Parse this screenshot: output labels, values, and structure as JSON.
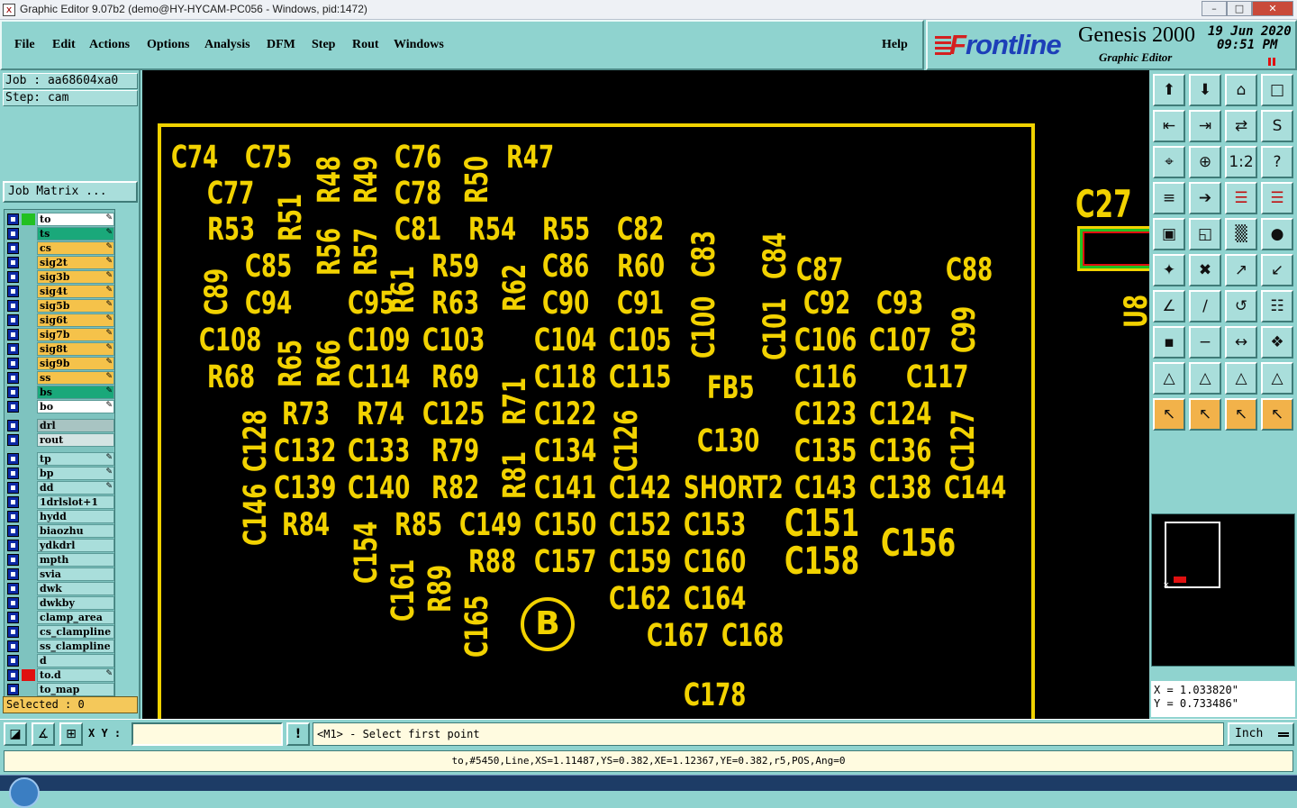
{
  "window": {
    "title": "Graphic Editor 9.07b2 (demo@HY-HYCAM-PC056 - Windows, pid:1472)",
    "icon": "x-app-icon",
    "controls": {
      "minimize": "–",
      "restore": "□",
      "close": "✕"
    }
  },
  "menu": {
    "items": [
      "File",
      "Edit",
      "Actions",
      "Options",
      "Analysis",
      "DFM",
      "Step",
      "Rout",
      "Windows"
    ],
    "help": "Help"
  },
  "brand": {
    "logo": "Frontline",
    "product": "Genesis 2000",
    "subtitle": "Graphic Editor",
    "date": "19 Jun 2020",
    "time": "09:51 PM"
  },
  "left": {
    "job": "Job : aa68604xa0",
    "step": "Step: cam",
    "job_matrix": "Job Matrix ...",
    "selected": "Selected : 0",
    "layers": [
      {
        "name": "to",
        "color": "#ffffff",
        "mark": "#22c022",
        "pen": true
      },
      {
        "name": "ts",
        "color": "#1aa87a",
        "pen": true
      },
      {
        "name": "cs",
        "color": "#f5c24a",
        "pen": true
      },
      {
        "name": "sig2t",
        "color": "#f5c24a",
        "pen": true
      },
      {
        "name": "sig3b",
        "color": "#f5c24a",
        "pen": true
      },
      {
        "name": "sig4t",
        "color": "#f5c24a",
        "pen": true
      },
      {
        "name": "sig5b",
        "color": "#f5c24a",
        "pen": true
      },
      {
        "name": "sig6t",
        "color": "#f5c24a",
        "pen": true
      },
      {
        "name": "sig7b",
        "color": "#f5c24a",
        "pen": true
      },
      {
        "name": "sig8t",
        "color": "#f5c24a",
        "pen": true
      },
      {
        "name": "sig9b",
        "color": "#f5c24a",
        "pen": true
      },
      {
        "name": "ss",
        "color": "#f5c24a",
        "pen": true
      },
      {
        "name": "bs",
        "color": "#1aa87a",
        "pen": true
      },
      {
        "name": "bo",
        "color": "#ffffff",
        "pen": true
      },
      {
        "name": "drl",
        "color": "#a8c4c2",
        "pen": false,
        "gap": 5
      },
      {
        "name": "rout",
        "color": "#d4e4e3",
        "pen": false
      },
      {
        "name": "tp",
        "color": "#a9dedb",
        "pen": true,
        "gap": 5
      },
      {
        "name": "bp",
        "color": "#a9dedb",
        "pen": true
      },
      {
        "name": "dd",
        "color": "#a9dedb",
        "pen": true
      },
      {
        "name": "1drlslot+1",
        "color": "#a9dedb",
        "pen": false
      },
      {
        "name": "hydd",
        "color": "#a9dedb",
        "pen": false
      },
      {
        "name": "biaozhu",
        "color": "#a9dedb",
        "pen": false
      },
      {
        "name": "ydkdrl",
        "color": "#a9dedb",
        "pen": false
      },
      {
        "name": "mpth",
        "color": "#a9dedb",
        "pen": false
      },
      {
        "name": "svia",
        "color": "#a9dedb",
        "pen": false
      },
      {
        "name": "dwk",
        "color": "#a9dedb",
        "pen": false
      },
      {
        "name": "dwkby",
        "color": "#a9dedb",
        "pen": false
      },
      {
        "name": "clamp_area",
        "color": "#a9dedb",
        "pen": false
      },
      {
        "name": "cs_clampline",
        "color": "#a9dedb",
        "pen": false
      },
      {
        "name": "ss_clampline",
        "color": "#a9dedb",
        "pen": false
      },
      {
        "name": "d",
        "color": "#a9dedb",
        "pen": false
      },
      {
        "name": "to.d",
        "color": "#a9dedb",
        "mark": "#e01010",
        "pen": true
      },
      {
        "name": "to_map",
        "color": "#a9dedb",
        "pen": false
      }
    ]
  },
  "canvas": {
    "labels": [
      "C74",
      "C75",
      "R48",
      "R49",
      "C76",
      "R50",
      "R47",
      "C77",
      "R51",
      "C78",
      "R53",
      "R56",
      "R57",
      "C81",
      "R54",
      "R55",
      "C82",
      "C83",
      "C84",
      "C89",
      "C85",
      "R61",
      "R59",
      "R62",
      "C86",
      "R60",
      "C87",
      "C88",
      "C94",
      "C95",
      "R63",
      "C90",
      "C91",
      "C100",
      "C101",
      "C92",
      "C93",
      "C99",
      "C108",
      "R65",
      "R66",
      "C109",
      "C103",
      "C104",
      "C105",
      "C106",
      "C107",
      "R68",
      "C114",
      "R69",
      "R71",
      "C118",
      "C115",
      "FB5",
      "C116",
      "C117",
      "C128",
      "R73",
      "R74",
      "C125",
      "C122",
      "C126",
      "C123",
      "C124",
      "C127",
      "C132",
      "C133",
      "R79",
      "C134",
      "C130",
      "C135",
      "C136",
      "C146",
      "C139",
      "C140",
      "R82",
      "R81",
      "C141",
      "C142",
      "SHORT2",
      "C143",
      "C138",
      "C144",
      "R84",
      "C154",
      "R85",
      "C149",
      "C150",
      "C152",
      "C153",
      "C151",
      "C156",
      "C161",
      "R89",
      "R88",
      "C157",
      "C159",
      "C160",
      "C158",
      "C165",
      "C162",
      "C164",
      "C167",
      "C168",
      "C178",
      "C27",
      "U8"
    ],
    "marker": "B"
  },
  "toolbar": {
    "icons": [
      "layer-up-icon",
      "layer-down-icon",
      "home-icon",
      "window-icon",
      "move-left-icon",
      "move-right-icon",
      "swap-icon",
      "s-curve-icon",
      "fit-icon",
      "zoom-icon",
      "ratio-icon",
      "help-icon",
      "filter-icon",
      "snap-icon",
      "traffic-icon",
      "traffic-red-icon",
      "pad-icon",
      "edit-shape-icon",
      "ruler-icon",
      "circle-icon",
      "connect-icon",
      "cross-icon",
      "line-add-icon",
      "line-remove-icon",
      "angle-icon",
      "slash-icon",
      "rotate-icon",
      "grid-icon",
      "point-icon",
      "minus-icon",
      "measure-icon",
      "group-icon",
      "triangle-a-icon",
      "triangle-b-icon",
      "triangle-c-icon",
      "triangle-d-icon",
      "pointer-icon",
      "select-box-icon",
      "select-circle-icon",
      "select-poly-icon"
    ],
    "icon_glyphs": [
      "⬆",
      "⬇",
      "⌂",
      "□",
      "⇤",
      "⇥",
      "⇄",
      "S",
      "⌖",
      "⊕",
      "1:2",
      "?",
      "≡",
      "➔",
      "☰",
      "☰",
      "▣",
      "◱",
      "▒",
      "●",
      "✦",
      "✖",
      "↗",
      "↙",
      "∠",
      "∕",
      "↺",
      "☷",
      "▪",
      "−",
      "↔",
      "❖",
      "△",
      "△",
      "△",
      "△",
      "↖",
      "↖",
      "↖",
      "↖"
    ],
    "orange": [
      36,
      37,
      38,
      39
    ]
  },
  "coords": {
    "x": "X = 1.033820\"",
    "y": "Y = 0.733486\""
  },
  "bottom": {
    "xy_label": "X Y :",
    "xy_value": "",
    "prompt_icon": "!",
    "prompt": "<M1> - Select first point",
    "units": "Inch"
  },
  "status": "to,#5450,Line,XS=1.11487,YS=0.382,XE=1.12367,YE=0.382,r5,POS,Ang=0"
}
